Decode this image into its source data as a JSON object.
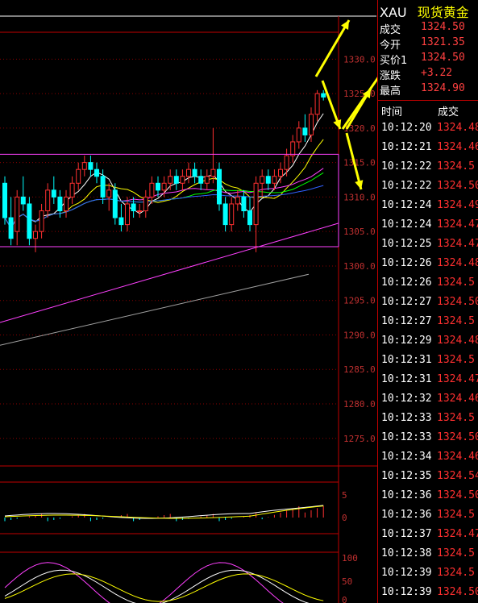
{
  "header": {
    "symbol": "XAU",
    "name": "现货黄金"
  },
  "quote": [
    {
      "label": "成交",
      "value": "1324.50"
    },
    {
      "label": "今开",
      "value": "1321.35"
    },
    {
      "label": "买价1",
      "value": "1324.50"
    },
    {
      "label": "涨跌",
      "value": "+3.22"
    },
    {
      "label": "最高",
      "value": "1324.90"
    }
  ],
  "ticks_header": {
    "time": "时间",
    "price": "成交"
  },
  "ticks": [
    {
      "time": "10:12:20",
      "price": "1324.48"
    },
    {
      "time": "10:12:21",
      "price": "1324.46"
    },
    {
      "time": "10:12:22",
      "price": "1324.5"
    },
    {
      "time": "10:12:22",
      "price": "1324.50"
    },
    {
      "time": "10:12:24",
      "price": "1324.49"
    },
    {
      "time": "10:12:24",
      "price": "1324.47"
    },
    {
      "time": "10:12:25",
      "price": "1324.47"
    },
    {
      "time": "10:12:26",
      "price": "1324.48"
    },
    {
      "time": "10:12:26",
      "price": "1324.5"
    },
    {
      "time": "10:12:27",
      "price": "1324.50"
    },
    {
      "time": "10:12:27",
      "price": "1324.5"
    },
    {
      "time": "10:12:29",
      "price": "1324.48"
    },
    {
      "time": "10:12:31",
      "price": "1324.5"
    },
    {
      "time": "10:12:31",
      "price": "1324.47"
    },
    {
      "time": "10:12:32",
      "price": "1324.46"
    },
    {
      "time": "10:12:33",
      "price": "1324.5"
    },
    {
      "time": "10:12:33",
      "price": "1324.50"
    },
    {
      "time": "10:12:34",
      "price": "1324.46"
    },
    {
      "time": "10:12:35",
      "price": "1324.54"
    },
    {
      "time": "10:12:36",
      "price": "1324.50"
    },
    {
      "time": "10:12:36",
      "price": "1324.5"
    },
    {
      "time": "10:12:37",
      "price": "1324.47"
    },
    {
      "time": "10:12:38",
      "price": "1324.5"
    },
    {
      "time": "10:12:39",
      "price": "1324.5"
    },
    {
      "time": "10:12:39",
      "price": "1324.50"
    }
  ],
  "price_axis": [
    "1330.0",
    "1325.0",
    "1320.0",
    "1315.0",
    "1310.0",
    "1305.0",
    "1300.0",
    "1295.0",
    "1290.0",
    "1285.0",
    "1280.0",
    "1275.0"
  ],
  "macd_axis": [
    "5",
    "0"
  ],
  "kdj_axis": [
    "100",
    "50",
    "0"
  ],
  "colors": {
    "up": "#ff3030",
    "down": "#00ffff",
    "grid": "#8b0000",
    "annotation": "#ffff00",
    "trendline": "#ff40ff"
  },
  "chart_data": {
    "type": "candlestick",
    "ylim": [
      1271,
      1336
    ],
    "candles": [
      [
        1312,
        1313,
        1306,
        1307
      ],
      [
        1307,
        1310,
        1303,
        1304
      ],
      [
        1305,
        1311,
        1303,
        1310
      ],
      [
        1310,
        1313,
        1308,
        1309
      ],
      [
        1309,
        1310,
        1303,
        1304
      ],
      [
        1304,
        1306,
        1302,
        1305
      ],
      [
        1305,
        1309,
        1304,
        1308
      ],
      [
        1308,
        1312,
        1307,
        1311
      ],
      [
        1311,
        1313,
        1309,
        1310
      ],
      [
        1310,
        1311,
        1307,
        1308
      ],
      [
        1308,
        1311,
        1307,
        1310
      ],
      [
        1310,
        1313,
        1309,
        1312
      ],
      [
        1312,
        1315,
        1311,
        1314
      ],
      [
        1314,
        1316,
        1313,
        1315
      ],
      [
        1315,
        1316,
        1313,
        1314
      ],
      [
        1314,
        1315,
        1312,
        1313
      ],
      [
        1313,
        1314,
        1309,
        1310
      ],
      [
        1310,
        1312,
        1308,
        1311
      ],
      [
        1311,
        1312,
        1306,
        1307
      ],
      [
        1307,
        1309,
        1305,
        1306
      ],
      [
        1306,
        1310,
        1305,
        1309
      ],
      [
        1309,
        1310,
        1307,
        1308
      ],
      [
        1308,
        1309,
        1307,
        1308
      ],
      [
        1308,
        1311,
        1307,
        1310
      ],
      [
        1310,
        1313,
        1309,
        1312
      ],
      [
        1312,
        1313,
        1310,
        1311
      ],
      [
        1311,
        1313,
        1310,
        1312
      ],
      [
        1312,
        1314,
        1311,
        1313
      ],
      [
        1313,
        1314,
        1311,
        1312
      ],
      [
        1312,
        1314,
        1311,
        1313
      ],
      [
        1313,
        1315,
        1312,
        1314
      ],
      [
        1314,
        1315,
        1312,
        1313
      ],
      [
        1313,
        1314,
        1311,
        1312
      ],
      [
        1312,
        1314,
        1311,
        1313
      ],
      [
        1313,
        1320,
        1312,
        1314
      ],
      [
        1314,
        1315,
        1308,
        1309
      ],
      [
        1309,
        1310,
        1305,
        1306
      ],
      [
        1306,
        1310,
        1305,
        1309
      ],
      [
        1309,
        1311,
        1308,
        1310
      ],
      [
        1310,
        1311,
        1307,
        1308
      ],
      [
        1308,
        1310,
        1305,
        1306
      ],
      [
        1306,
        1313,
        1302,
        1312
      ],
      [
        1312,
        1314,
        1310,
        1313
      ],
      [
        1313,
        1314,
        1311,
        1312
      ],
      [
        1312,
        1314,
        1311,
        1313
      ],
      [
        1313,
        1315,
        1312,
        1314
      ],
      [
        1314,
        1317,
        1313,
        1316
      ],
      [
        1316,
        1319,
        1315,
        1318
      ],
      [
        1318,
        1321,
        1317,
        1320
      ],
      [
        1320,
        1322,
        1318,
        1319
      ],
      [
        1319,
        1323,
        1318,
        1322
      ],
      [
        1322,
        1325.5,
        1321,
        1325
      ],
      [
        1325,
        1325.5,
        1324,
        1324.5
      ]
    ]
  }
}
